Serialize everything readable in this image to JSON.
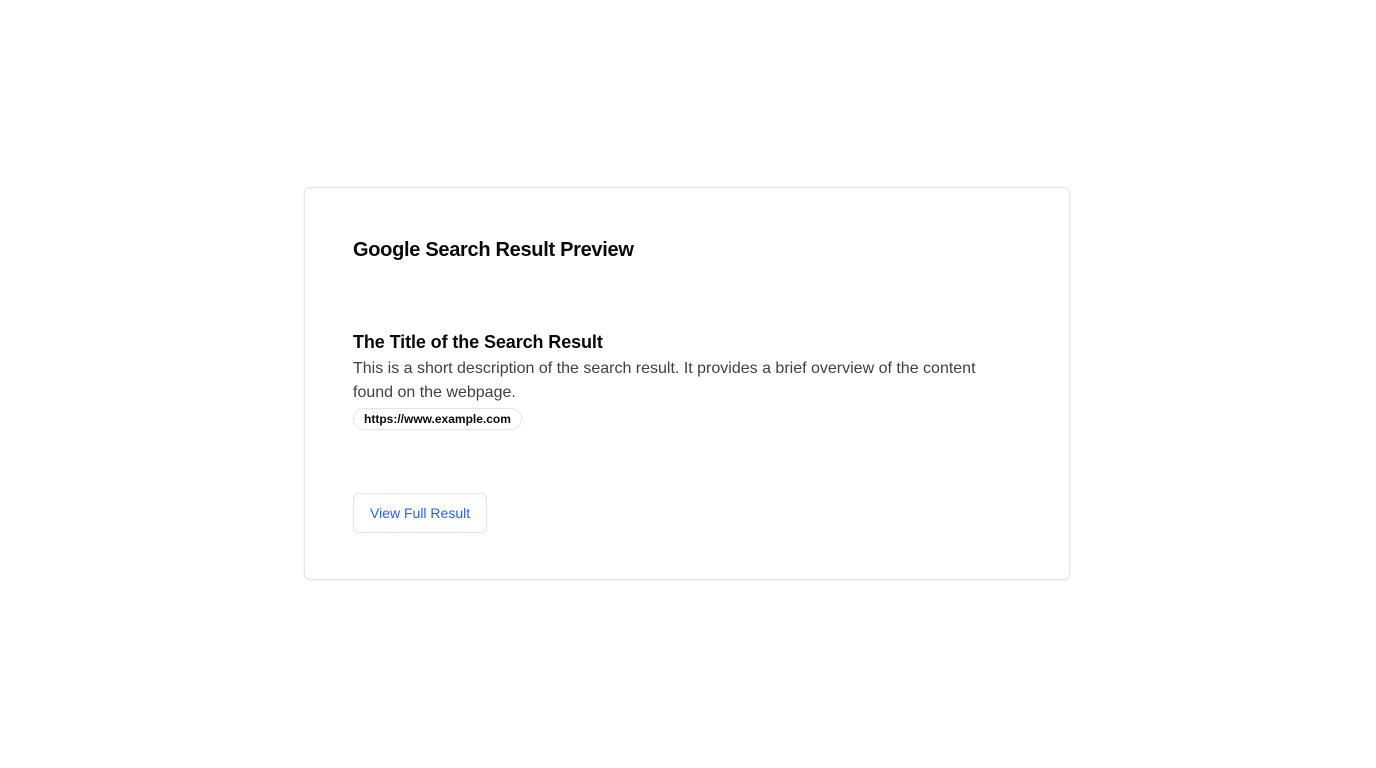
{
  "card": {
    "title": "Google Search Result Preview"
  },
  "result": {
    "title": "The Title of the Search Result",
    "description": "This is a short description of the search result. It provides a brief overview of the content found on the webpage.",
    "url": "https://www.example.com"
  },
  "actions": {
    "view_full_label": "View Full Result"
  },
  "colors": {
    "accent": "#2563eb",
    "border": "#e4e4e7",
    "text_primary": "#09090b",
    "text_secondary": "#3f3f46"
  }
}
